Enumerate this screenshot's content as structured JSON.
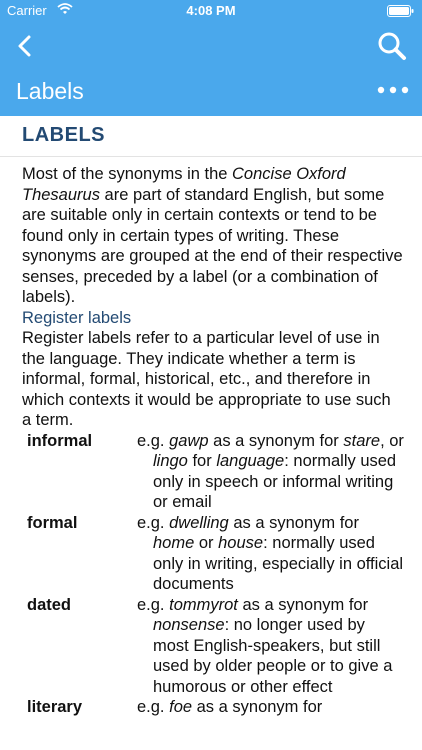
{
  "status": {
    "carrier": "Carrier",
    "time": "4:08 PM"
  },
  "nav": {
    "title": "Labels"
  },
  "article": {
    "heading": "LABELS",
    "intro": {
      "p1": "Most of the synonyms in the ",
      "book": "Concise Oxford Thesaurus",
      "p2": " are part of standard English, but some are suitable only in certain contexts or tend to be found only in certain types of writing. These synonyms are grouped at the end of their respective senses, preceded by a label (or a combination of labels)."
    },
    "subheading": "Register labels",
    "register_text": "Register labels refer to a particular level of use in the language. They indicate whether a term is informal, formal, historical, etc., and therefore in which contexts it would be appropriate to use such a term.",
    "terms": [
      {
        "label": "informal",
        "s1": "e.g. ",
        "w1": "gawp",
        "s2": " as a synonym for ",
        "w2": "stare",
        "s3": ", or ",
        "w3": "lingo",
        "s4": " for ",
        "w4": "language",
        "s5": ": normally used only in speech or informal writing or email"
      },
      {
        "label": "formal",
        "s1": "e.g. ",
        "w1": "dwelling",
        "s2": " as a synonym for ",
        "w2": "home",
        "s3": " or ",
        "w3": "house",
        "s4": ": normally used only in writing, especially in official documents"
      },
      {
        "label": "dated",
        "s1": "e.g. ",
        "w1": "tommyrot",
        "s2": " as a synonym for ",
        "w2": "nonsense",
        "s3": ": no longer used by most English-speakers, but still used by older people or to give a humorous or other effect"
      },
      {
        "label": "literary",
        "s1": "e.g. ",
        "w1": "foe",
        "s2": " as a synonym for"
      }
    ]
  }
}
